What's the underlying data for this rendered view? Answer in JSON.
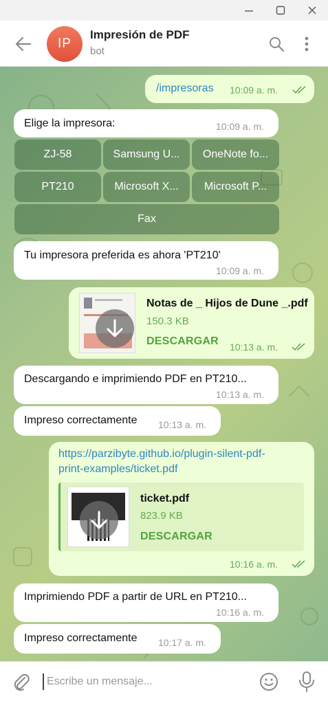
{
  "window": {
    "controls": [
      "minimize",
      "maximize",
      "close"
    ]
  },
  "header": {
    "avatar_initials": "IP",
    "title": "Impresión de PDF",
    "subtitle": "bot",
    "icons": [
      "arrow-left-icon",
      "search-icon",
      "more-vertical-icon"
    ]
  },
  "messages": {
    "m1": {
      "text": "/impresoras",
      "time": "10:09 a. m."
    },
    "m2": {
      "text": "Elige la impresora:",
      "time": "10:09 a. m."
    },
    "keyboard": [
      "ZJ-58",
      "Samsung U...",
      "OneNote fo...",
      "PT210",
      "Microsoft X...",
      "Microsoft P...",
      "Fax"
    ],
    "m3": {
      "text": "Tu impresora preferida es ahora 'PT210'",
      "time": "10:09 a. m."
    },
    "m4": {
      "file_name": "Notas de _ Hijos de Dune _.pdf",
      "file_size": "150.3 KB",
      "action": "DESCARGAR",
      "time": "10:13 a. m."
    },
    "m5": {
      "text": "Descargando e imprimiendo PDF en PT210...",
      "time": "10:13 a. m."
    },
    "m6": {
      "text": "Impreso correctamente",
      "time": "10:13 a. m."
    },
    "m7": {
      "link_line1": "https://parzibyte.github.io/plugin-silent-pdf-",
      "link_line2": "print-examples/ticket.pdf",
      "file_name": "ticket.pdf",
      "file_size": "823.9 KB",
      "action": "DESCARGAR",
      "time": "10:16 a. m."
    },
    "m8": {
      "text": "Imprimiendo PDF a partir de URL en PT210...",
      "time": "10:16 a. m."
    },
    "m9": {
      "text": "Impreso correctamente",
      "time": "10:17 a. m."
    }
  },
  "composer": {
    "placeholder": "Escribe un mensaje...",
    "icons": [
      "paperclip-icon",
      "emoji-icon",
      "microphone-icon"
    ]
  },
  "colors": {
    "outgoing_bubble": "#eefed7",
    "incoming_bubble": "#ffffff",
    "time_green": "#62ac55",
    "link_blue": "#2e86c1",
    "avatar": "#e0513a"
  }
}
